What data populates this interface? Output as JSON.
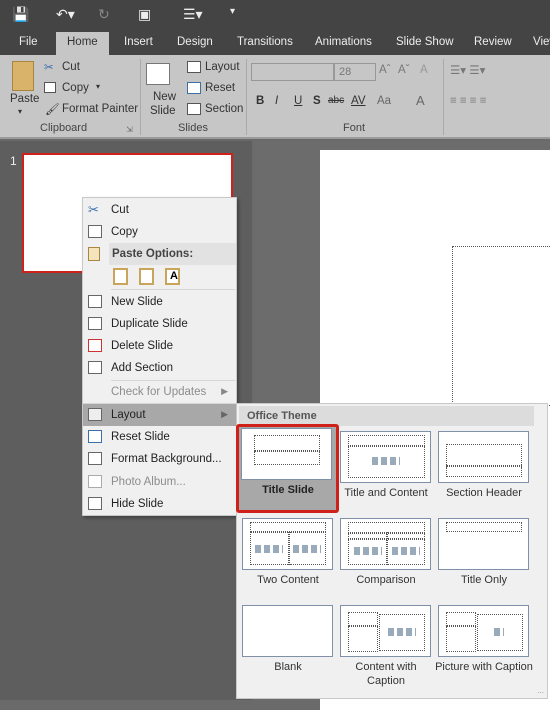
{
  "quick_access": {
    "icons": [
      "save-icon",
      "undo-icon",
      "redo-icon",
      "present-icon",
      "align-icon",
      "customize-icon"
    ]
  },
  "tabs": [
    "File",
    "Home",
    "Insert",
    "Design",
    "Transitions",
    "Animations",
    "Slide Show",
    "Review",
    "View"
  ],
  "active_tab": "Home",
  "ribbon": {
    "clipboard": {
      "paste": "Paste",
      "cut": "Cut",
      "copy": "Copy",
      "format_painter": "Format Painter",
      "group": "Clipboard"
    },
    "slides": {
      "new_slide_1": "New",
      "new_slide_2": "Slide",
      "layout": "Layout",
      "reset": "Reset",
      "section": "Section",
      "group": "Slides"
    },
    "font": {
      "font_name": "",
      "font_size": "28",
      "bold": "B",
      "italic": "I",
      "underline": "U",
      "shadow": "S",
      "strike": "abc",
      "spacing": "AV",
      "case": "Aa",
      "color": "A",
      "group": "Font"
    }
  },
  "slide_panel": {
    "slide_number": "1"
  },
  "context_menu": {
    "items": [
      {
        "label": "Cut",
        "icon": "scissors-icon"
      },
      {
        "label": "Copy",
        "icon": "copy-icon"
      },
      {
        "label": "Paste Options:",
        "icon": "paste-icon"
      },
      {
        "label": "New Slide",
        "icon": "new-slide-icon"
      },
      {
        "label": "Duplicate Slide",
        "icon": "duplicate-slide-icon"
      },
      {
        "label": "Delete Slide",
        "icon": "delete-slide-icon"
      },
      {
        "label": "Add Section",
        "icon": "add-section-icon"
      },
      {
        "label": "Check for Updates",
        "disabled": true
      },
      {
        "label": "Layout",
        "icon": "layout-icon",
        "highlighted": true
      },
      {
        "label": "Reset Slide",
        "icon": "reset-slide-icon"
      },
      {
        "label": "Format Background...",
        "icon": "format-background-icon"
      },
      {
        "label": "Photo Album...",
        "icon": "photo-album-icon",
        "disabled": true
      },
      {
        "label": "Hide Slide",
        "icon": "hide-slide-icon"
      }
    ]
  },
  "layout_submenu": {
    "header": "Office Theme",
    "layouts": [
      "Title Slide",
      "Title and Content",
      "Section Header",
      "Two Content",
      "Comparison",
      "Title Only",
      "Blank",
      "Content with Caption",
      "Picture with Caption"
    ],
    "selected": "Title Slide"
  },
  "colors": {
    "selection": "#d0201a",
    "title_bar": "#444444"
  }
}
